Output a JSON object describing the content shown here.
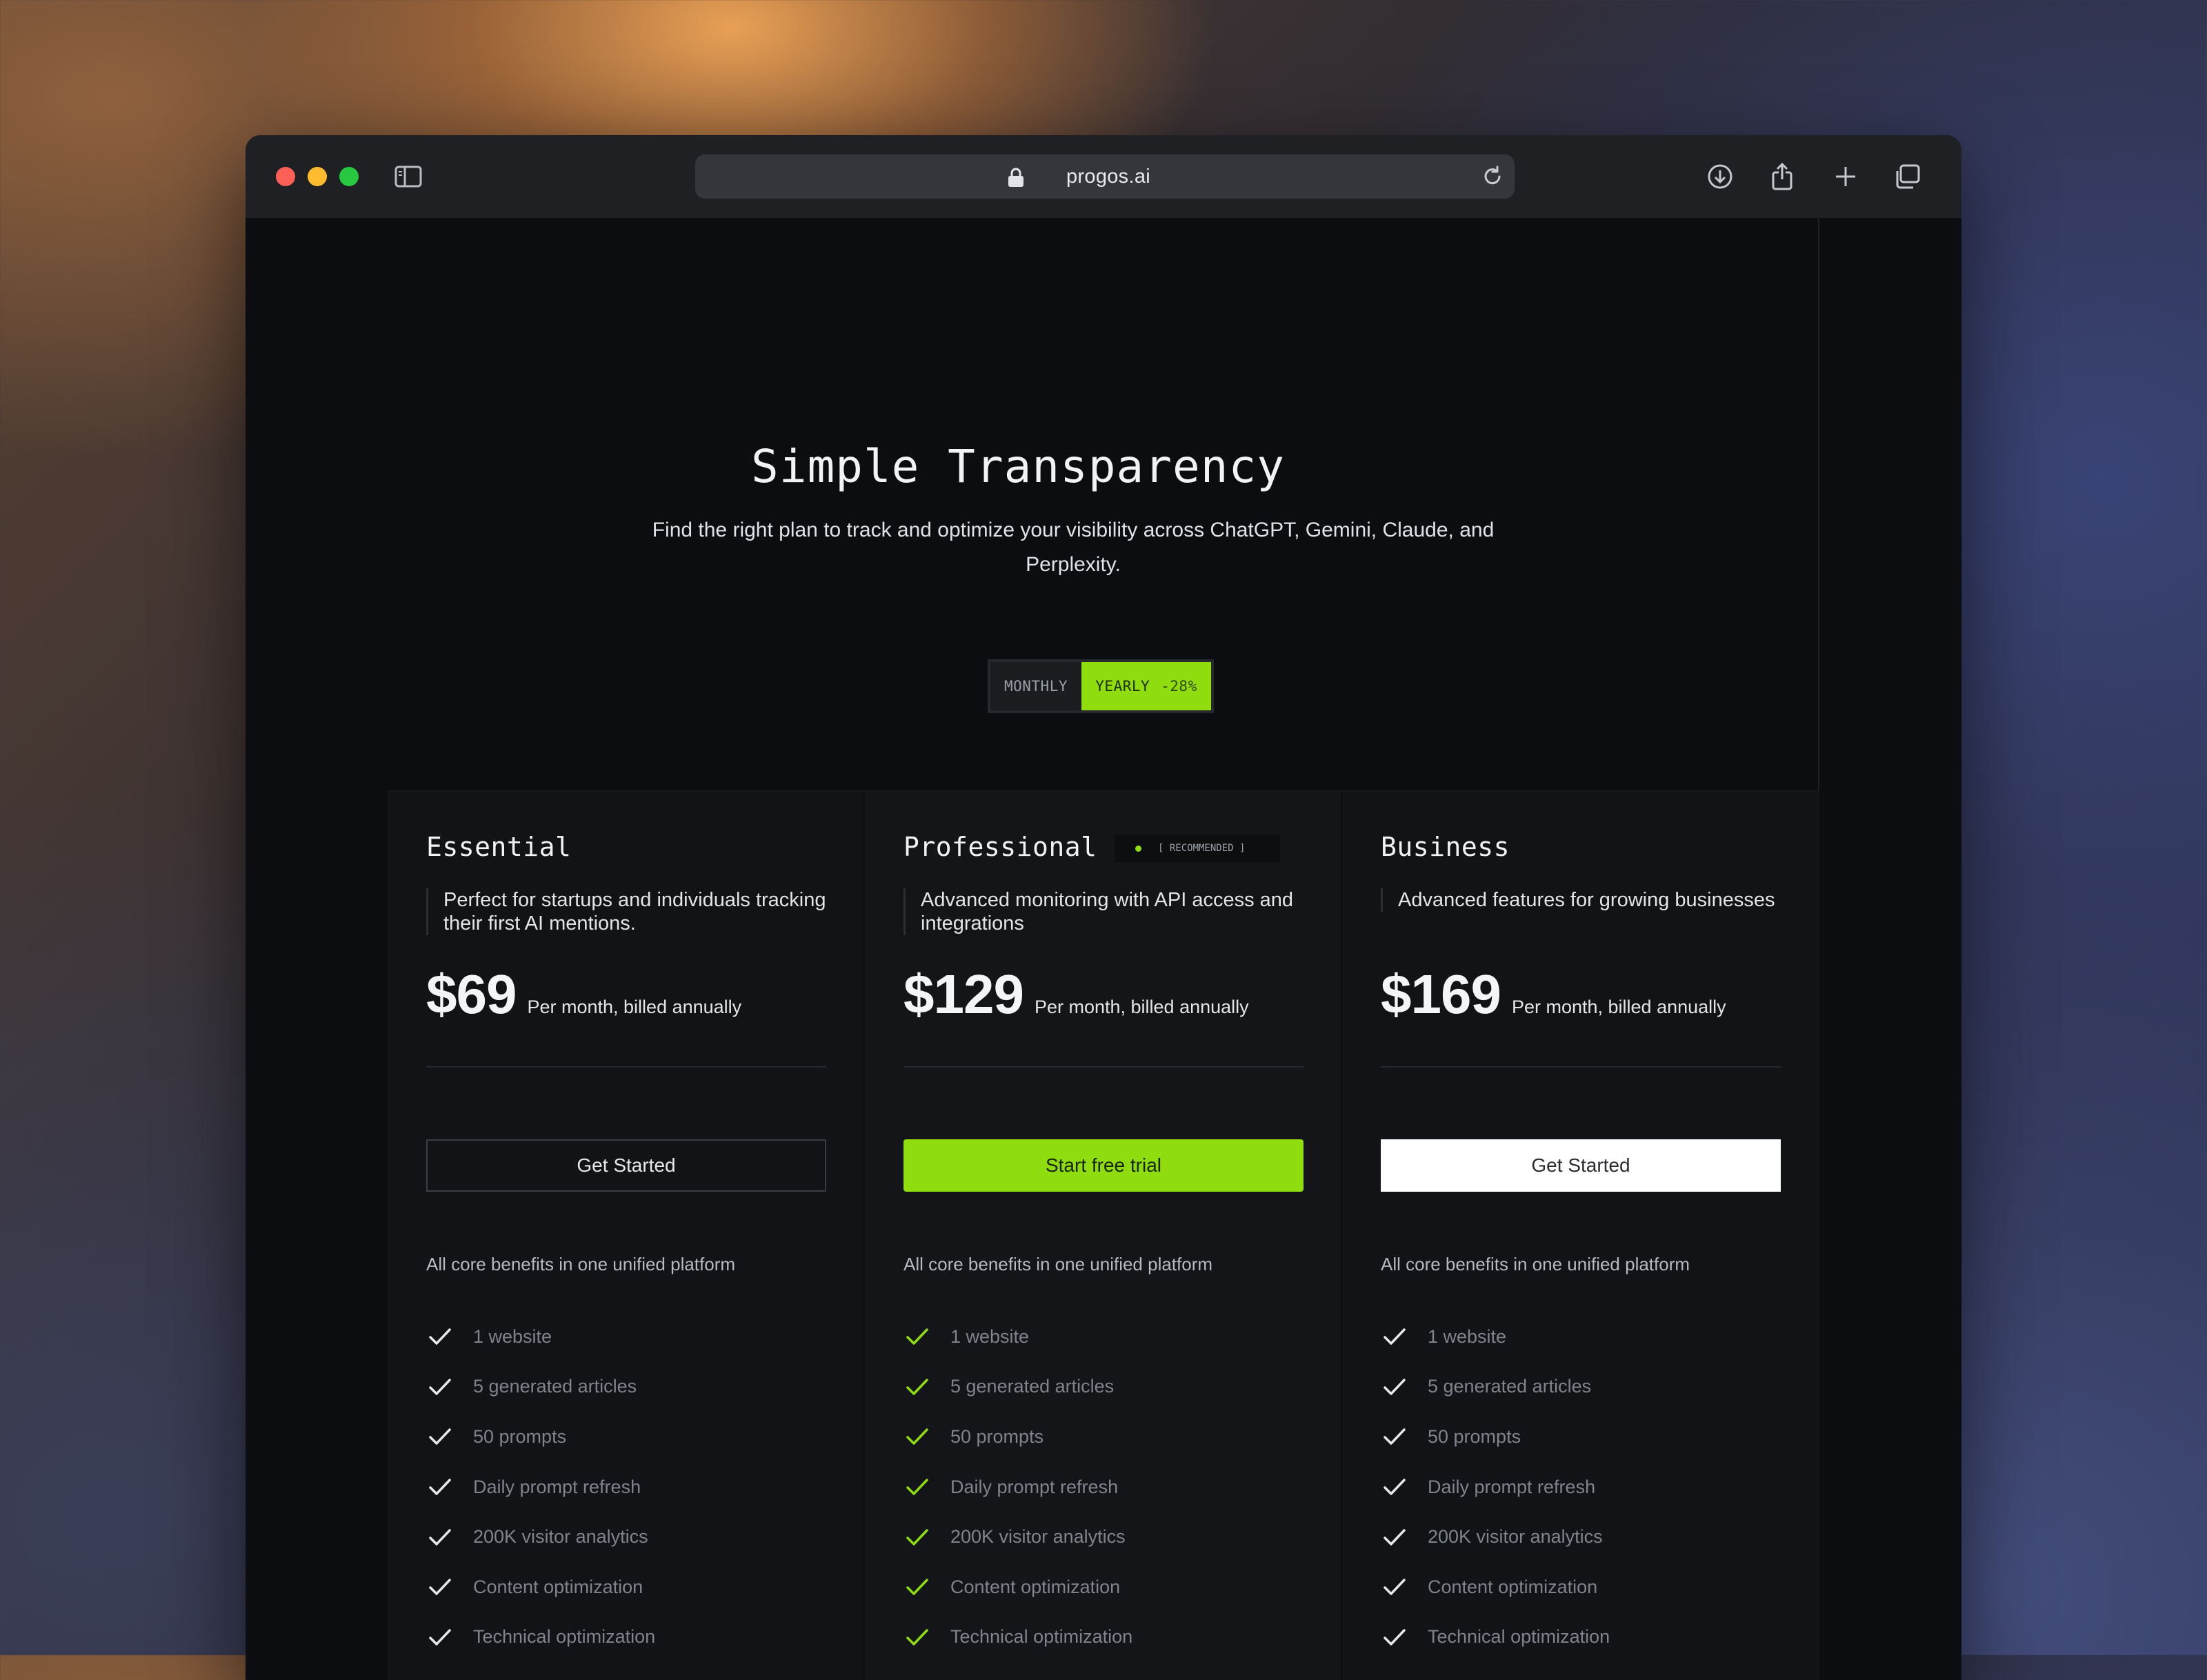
{
  "browser": {
    "url": "progos.ai"
  },
  "hero": {
    "title": "Simple Transparency",
    "subtitle": "Find the right plan to track and optimize your visibility across ChatGPT, Gemini, Claude, and Perplexity."
  },
  "billing_toggle": {
    "monthly_label": "MONTHLY",
    "yearly_label": "YEARLY",
    "yearly_discount": "-28%",
    "selected": "yearly"
  },
  "colors": {
    "accent": "#8fdd0f",
    "background": "#0c0d10",
    "card": "#121316"
  },
  "plans": [
    {
      "name": "Essential",
      "description": "Perfect for startups and individuals tracking their first AI mentions.",
      "price": "$69",
      "price_note": "Per month, billed annually",
      "cta": "Get Started",
      "features_title": "All core benefits in one unified platform",
      "features": [
        "1 website",
        "5 generated articles",
        "50 prompts",
        "Daily prompt refresh",
        "200K visitor analytics",
        "Content optimization",
        "Technical optimization"
      ]
    },
    {
      "name": "Professional",
      "badge": "[ RECOMMENDED ]",
      "description": "Advanced monitoring with API access and integrations",
      "price": "$129",
      "price_note": "Per month, billed annually",
      "cta": "Start free trial",
      "features_title": "All core benefits in one unified platform",
      "features": [
        "1 website",
        "5 generated articles",
        "50 prompts",
        "Daily prompt refresh",
        "200K visitor analytics",
        "Content optimization",
        "Technical optimization"
      ]
    },
    {
      "name": "Business",
      "description": "Advanced features for growing businesses",
      "price": "$169",
      "price_note": "Per month, billed annually",
      "cta": "Get Started",
      "features_title": "All core benefits in one unified platform",
      "features": [
        "1 website",
        "5 generated articles",
        "50 prompts",
        "Daily prompt refresh",
        "200K visitor analytics",
        "Content optimization",
        "Technical optimization"
      ]
    }
  ]
}
